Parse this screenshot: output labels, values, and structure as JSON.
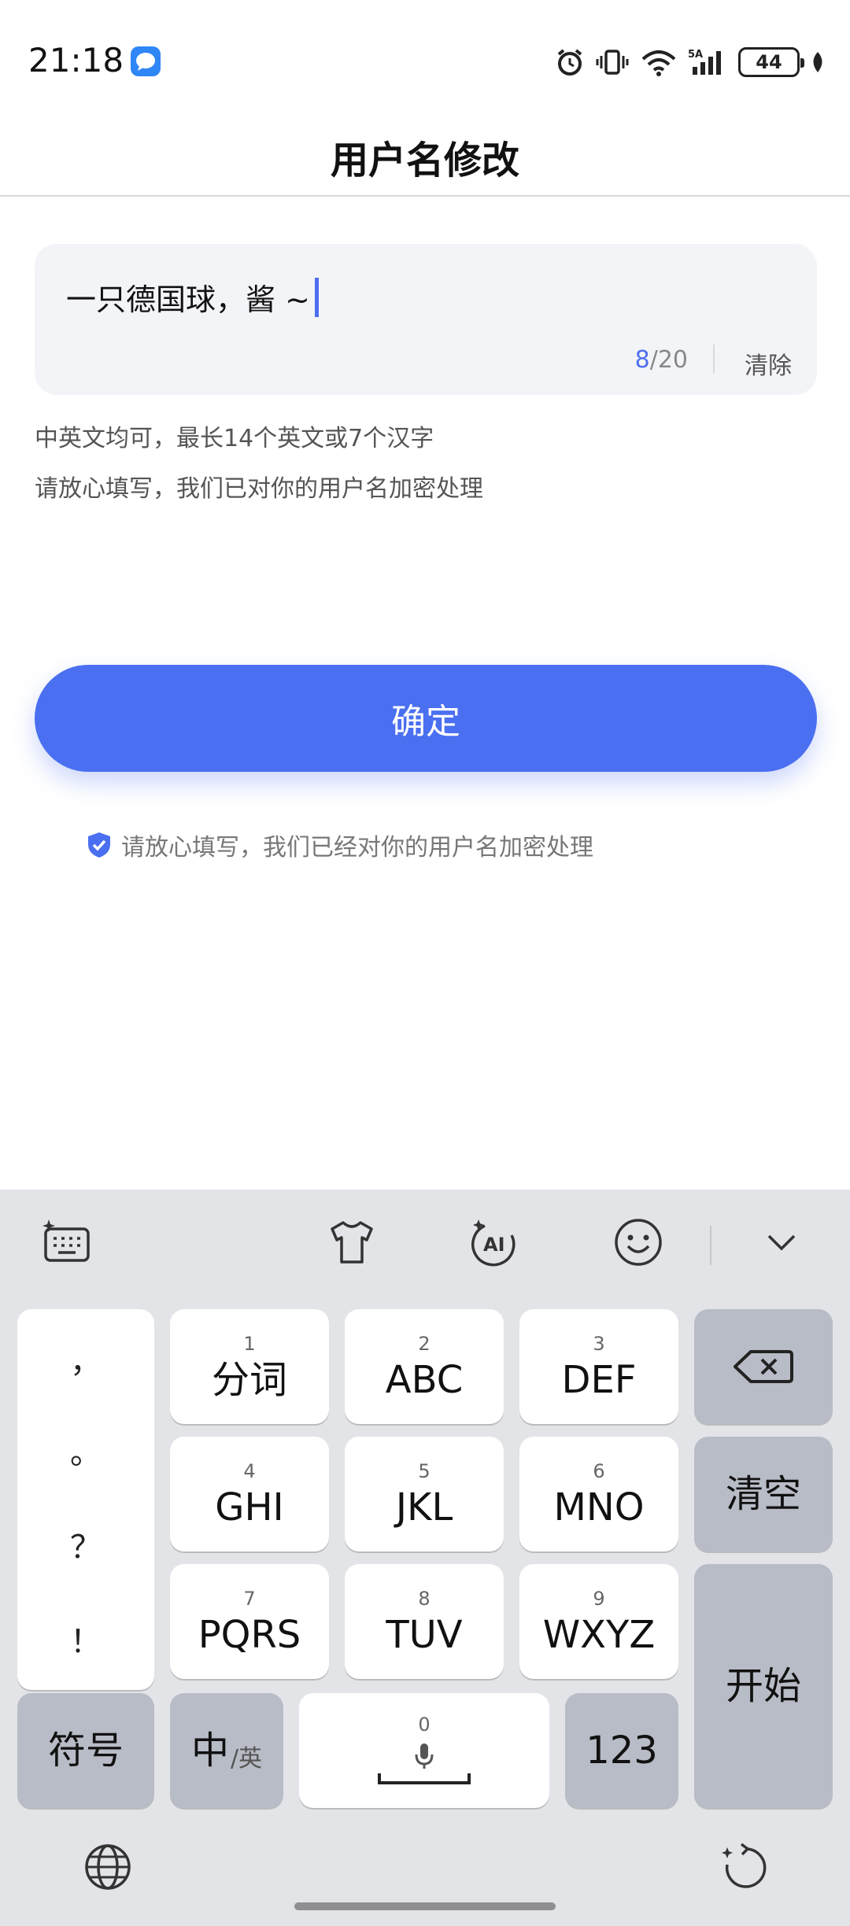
{
  "status_bar": {
    "time": "21:18",
    "battery": "44"
  },
  "header": {
    "title": "用户名修改"
  },
  "input": {
    "value": "一只德国球，酱 ~",
    "count_current": "8",
    "count_max": "/20",
    "clear_label": "清除"
  },
  "hints": [
    "中英文均可，最长14个英文或7个汉字",
    "请放心填写，我们已对你的用户名加密处理"
  ],
  "confirm_label": "确定",
  "privacy_note": "请放心填写，我们已经对你的用户名加密处理",
  "keyboard": {
    "punctuation": [
      "，",
      "。",
      "？",
      "！"
    ],
    "keys": [
      {
        "num": "1",
        "label": "分词"
      },
      {
        "num": "2",
        "label": "ABC"
      },
      {
        "num": "3",
        "label": "DEF"
      },
      {
        "num": "4",
        "label": "GHI"
      },
      {
        "num": "5",
        "label": "JKL"
      },
      {
        "num": "6",
        "label": "MNO"
      },
      {
        "num": "7",
        "label": "PQRS"
      },
      {
        "num": "8",
        "label": "TUV"
      },
      {
        "num": "9",
        "label": "WXYZ"
      }
    ],
    "clear_label": "清空",
    "start_label": "开始",
    "symbols_label": "符号",
    "lang_main": "中",
    "lang_alt": "/英",
    "space_num": "0",
    "numbers_label": "123"
  }
}
